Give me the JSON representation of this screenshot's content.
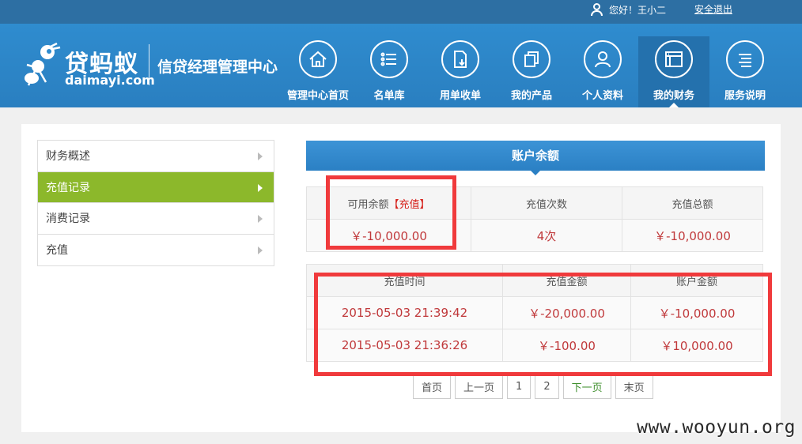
{
  "topbar": {
    "greeting": "您好！王小二",
    "logout": "安全退出"
  },
  "header": {
    "logo_cn": "贷蚂蚁",
    "logo_en": "daimayi.com",
    "subtitle": "信贷经理管理中心",
    "nav": [
      {
        "label": "管理中心首页",
        "icon": "home-icon"
      },
      {
        "label": "名单库",
        "icon": "list-icon"
      },
      {
        "label": "用单收单",
        "icon": "document-download-icon"
      },
      {
        "label": "我的产品",
        "icon": "product-icon"
      },
      {
        "label": "个人资料",
        "icon": "person-icon"
      },
      {
        "label": "我的财务",
        "icon": "finance-icon",
        "active": true
      },
      {
        "label": "服务说明",
        "icon": "menu-icon"
      }
    ]
  },
  "sidebar": {
    "items": [
      {
        "label": "财务概述"
      },
      {
        "label": "充值记录",
        "active": true
      },
      {
        "label": "消费记录"
      },
      {
        "label": "充值"
      }
    ]
  },
  "balance": {
    "title": "账户余额",
    "headers": {
      "available": "可用余额",
      "recharge_link": "【充值】",
      "count": "充值次数",
      "total": "充值总额"
    },
    "values": {
      "available": "￥-10,000.00",
      "count": "4次",
      "total": "￥-10,000.00"
    }
  },
  "records": {
    "headers": [
      "充值时间",
      "充值金额",
      "账户金额"
    ],
    "rows": [
      [
        "2015-05-03 21:39:42",
        "￥-20,000.00",
        "￥-10,000.00"
      ],
      [
        "2015-05-03 21:36:26",
        "￥-100.00",
        "￥10,000.00"
      ]
    ]
  },
  "pager": {
    "first": "首页",
    "prev": "上一页",
    "page1": "1",
    "page2": "2",
    "next": "下一页",
    "last": "末页"
  },
  "watermark": "www.wooyun.org",
  "colors": {
    "header_blue": "#2f8ccf",
    "active_green": "#8cb82b",
    "value_red": "#c0393b",
    "annotation_red": "#f03a3c"
  }
}
